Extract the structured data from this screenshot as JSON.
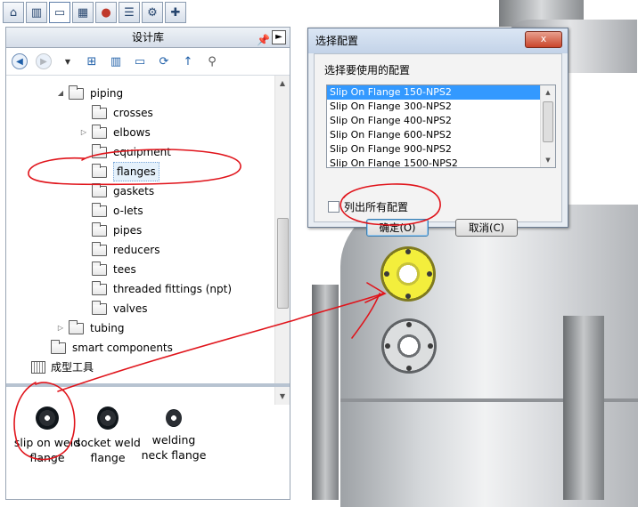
{
  "command_tabs": [
    "home-icon",
    "parts-icon",
    "folder-icon",
    "appearance-icon",
    "color-icon",
    "list-icon",
    "tasks-icon",
    "toolbox-icon"
  ],
  "design_library": {
    "title": "设计库",
    "toolbar": [
      "back-icon",
      "forward-icon",
      "dropdown-icon",
      "add-location-icon",
      "add-part-icon",
      "new-folder-icon",
      "refresh-icon",
      "up-icon",
      "toolbox-icon"
    ],
    "tree": [
      {
        "label": "piping",
        "expanded": true
      },
      {
        "label": "crosses"
      },
      {
        "label": "elbows"
      },
      {
        "label": "equipment"
      },
      {
        "label": "flanges",
        "selected": true
      },
      {
        "label": "gaskets"
      },
      {
        "label": "o-lets"
      },
      {
        "label": "pipes"
      },
      {
        "label": "reducers"
      },
      {
        "label": "tees"
      },
      {
        "label": "threaded fittings (npt)"
      },
      {
        "label": "valves"
      },
      {
        "label": "tubing"
      },
      {
        "label": "smart components"
      },
      {
        "label": "成型工具"
      }
    ],
    "items": [
      {
        "line1": "slip on weld",
        "line2": "flange"
      },
      {
        "line1": "socket weld",
        "line2": "flange"
      },
      {
        "line1": "welding",
        "line2": "neck flange"
      }
    ]
  },
  "dialog": {
    "title": "选择配置",
    "close_label": "x",
    "prompt": "选择要使用的配置",
    "configs": [
      "Slip On Flange 150-NPS2",
      "Slip On Flange 300-NPS2",
      "Slip On Flange 400-NPS2",
      "Slip On Flange 600-NPS2",
      "Slip On Flange 900-NPS2",
      "Slip On Flange 1500-NPS2"
    ],
    "selected_index": 0,
    "checkbox_label": "列出所有配置",
    "ok_label": "确定(O)",
    "cancel_label": "取消(C)"
  },
  "annotation_color": "#e0141b"
}
